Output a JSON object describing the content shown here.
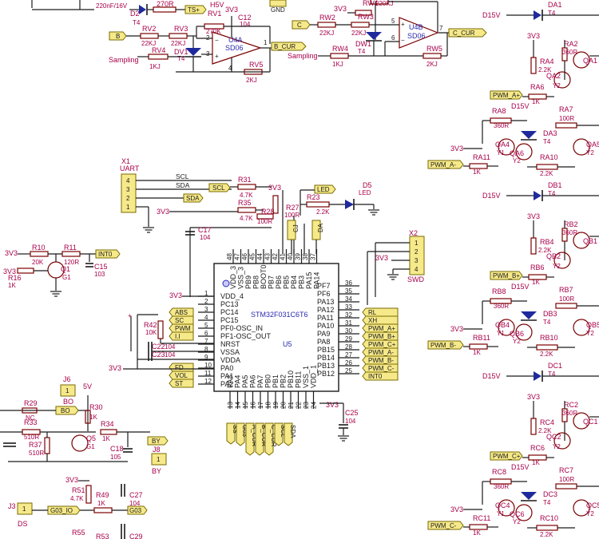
{
  "mcu": {
    "ref": "U5",
    "name": "STM32F031C6T6",
    "left_pins": [
      {
        "num": "1",
        "name": "VDD_4"
      },
      {
        "num": "2",
        "name": "PC13"
      },
      {
        "num": "3",
        "name": "PC14"
      },
      {
        "num": "4",
        "name": "PC15"
      },
      {
        "num": "5",
        "name": "PF0-OSC_IN"
      },
      {
        "num": "6",
        "name": "PF1-OSC_OUT"
      },
      {
        "num": "7",
        "name": "NRST"
      },
      {
        "num": "8",
        "name": "VSSA"
      },
      {
        "num": "9",
        "name": "VDDA"
      },
      {
        "num": "10",
        "name": "PA0"
      },
      {
        "num": "11",
        "name": "PA1"
      },
      {
        "num": "12",
        "name": "PA2"
      }
    ],
    "right_pins": [
      {
        "num": "36",
        "name": "PF7"
      },
      {
        "num": "35",
        "name": "PF6"
      },
      {
        "num": "34",
        "name": "PA13"
      },
      {
        "num": "33",
        "name": "PA12"
      },
      {
        "num": "32",
        "name": "PA11"
      },
      {
        "num": "31",
        "name": "PA10"
      },
      {
        "num": "30",
        "name": "PA9"
      },
      {
        "num": "29",
        "name": "PA8"
      },
      {
        "num": "28",
        "name": "PB15"
      },
      {
        "num": "27",
        "name": "PB14"
      },
      {
        "num": "26",
        "name": "PB13"
      },
      {
        "num": "25",
        "name": "PB12"
      }
    ],
    "top_pins": [
      {
        "num": "48",
        "name": "VDD_3"
      },
      {
        "num": "47",
        "name": "VSS_3"
      },
      {
        "num": "46",
        "name": "PB9"
      },
      {
        "num": "45",
        "name": "PB8"
      },
      {
        "num": "44",
        "name": "BOOT0"
      },
      {
        "num": "43",
        "name": "PB7"
      },
      {
        "num": "42",
        "name": "PB6"
      },
      {
        "num": "41",
        "name": "PB5"
      },
      {
        "num": "40",
        "name": "PB4"
      },
      {
        "num": "39",
        "name": "PB3"
      },
      {
        "num": "38",
        "name": "PA15"
      },
      {
        "num": "37",
        "name": "PA14"
      }
    ],
    "bottom_pins": [
      {
        "num": "13",
        "name": "PA3"
      },
      {
        "num": "14",
        "name": "PA4"
      },
      {
        "num": "15",
        "name": "PA5"
      },
      {
        "num": "16",
        "name": "PA6"
      },
      {
        "num": "17",
        "name": "PA7"
      },
      {
        "num": "18",
        "name": "PB0"
      },
      {
        "num": "19",
        "name": "PB1"
      },
      {
        "num": "20",
        "name": "PB2"
      },
      {
        "num": "21",
        "name": "PB10"
      },
      {
        "num": "22",
        "name": "PB11"
      },
      {
        "num": "23",
        "name": "VSS_1"
      },
      {
        "num": "24",
        "name": "VDD_1"
      }
    ]
  },
  "right_flags": [
    "RL",
    "XH",
    "PWM_A+",
    "PWM_B+",
    "PWM_C+",
    "PWM_A-",
    "PWM_B-",
    "PWM_C-",
    "INT0"
  ],
  "left_flags": [
    "ABS",
    "SC",
    "PWM",
    "I.I"
  ],
  "left_flags2": [
    "FD",
    "VOL",
    "ST"
  ],
  "bottom_flags": [
    "SS",
    "G03",
    "A_CUR",
    "B_CUR",
    "C_CUR",
    "SCL",
    "SDA"
  ],
  "top_flags": [
    "CJ",
    "DA"
  ],
  "opamp_a": {
    "ref": "U4A",
    "part": "SD06",
    "rv1": "RV1",
    "rv1_val": "270K",
    "rv2": "RV2",
    "rv2_val": "22KJ",
    "rv3": "RV3",
    "rv3_val": "22KJ",
    "rv4": "RV4",
    "rv4_val": "1KJ",
    "rv5": "RV5",
    "rv5_val": "2KJ",
    "dv1": "DV1",
    "dv1_val": "T4",
    "c12": "C12",
    "c12_val": "104",
    "supply": "3V3",
    "out": "B_CUR",
    "in": "B",
    "sampling": "Sampling",
    "gnd": "GND",
    "cap_top": "220nF/16V",
    "d2": "D2",
    "d2_val": "T4",
    "r270": "270R",
    "ts": "TS+",
    "h5v": "H5V"
  },
  "opamp_b": {
    "ref": "U4B",
    "part": "SD06",
    "rw1": "RW1",
    "rw1_val": "220KJ",
    "rw2": "RW2",
    "rw2_val": "22KJ",
    "rw3": "RW3",
    "rw3_val": "22KJ",
    "rw4": "RW4",
    "rw4_val": "1KJ",
    "rw5": "RW5",
    "rw5_val": "2KJ",
    "dw1": "DW1",
    "dw1_val": "T4",
    "supply": "3V3",
    "out": "C_CUR",
    "in": "C",
    "sampling": "Sampling",
    "pin5": "5",
    "pin6": "6",
    "pin7": "7"
  },
  "uart": {
    "ref": "X1",
    "name": "UART",
    "scl": "SCL",
    "sda": "SDA",
    "pins": [
      "4",
      "3",
      "2",
      "1"
    ],
    "r31": "R31",
    "r31_val": "4.7K",
    "r35": "R35",
    "r35_val": "4.7K",
    "r28": "R28",
    "r28_val": "100R",
    "supply": "3V3"
  },
  "led": {
    "d5": "D5",
    "d5_val": "LED",
    "r23": "R23",
    "r23_val": "2.2K",
    "r27": "R27",
    "r27_val": "100R",
    "net": "LED",
    "supply": "3V3"
  },
  "c17": {
    "ref": "C17",
    "val": "104"
  },
  "swd": {
    "ref": "X2",
    "name": "SWD",
    "pins": [
      "1",
      "2",
      "3",
      "4"
    ],
    "supply": "3V3"
  },
  "int0": {
    "r10": "R10",
    "r10_val": "20K",
    "r11": "R11",
    "r11_val": "120R",
    "c15": "C15",
    "c15_val": "103",
    "r16": "R16",
    "r16_val": "1K",
    "q1": "Q1",
    "q1_val": "G1",
    "supply": "3V3",
    "net": "INT0"
  },
  "reset": {
    "r42": "R42",
    "r42_val": "10K",
    "c22": "C22",
    "c22_val": "104",
    "c23": "C23",
    "c23_val": "104",
    "supply": "3V3"
  },
  "c25": {
    "ref": "C25",
    "val": "104",
    "supply": "3V3"
  },
  "bottom_left": {
    "j6": "J6",
    "j6_pin": "1",
    "bo": "BO",
    "r29": "R29",
    "r29_val": "NC",
    "r33": "R33",
    "r33_val": "510R",
    "r37": "R37",
    "r37_val": "510R",
    "r30": "R30",
    "r30_val": "1K",
    "r34": "R34",
    "r34_val": "1K",
    "q5": "Q5",
    "q5_val": "G1",
    "c18": "C18",
    "c18_val": "105",
    "j8": "J8",
    "j8_pin": "1",
    "by": "BY",
    "v5": "5V",
    "r51": "R51",
    "r51_val": "4.7K",
    "r49": "R49",
    "r49_val": "1K",
    "c27": "C27",
    "c27_val": "104",
    "g03": "G03_IO",
    "g03b": "G03",
    "j3": "J3",
    "j3_pin": "1",
    "ds": "DS",
    "r55": "R55",
    "r53": "R53",
    "c29": "C29",
    "supply": "3V3"
  },
  "phases": [
    {
      "d15": "D15V",
      "d": "DA1",
      "d_val": "T4",
      "ra2": "RA2",
      "ra2_val": "360R",
      "ra4": "RA4",
      "ra4_val": "2.2K",
      "qa1": "QA1",
      "qa2": "QA2",
      "qa2_val": "Y2",
      "ra6": "RA6",
      "ra6_val": "1K",
      "pwm_hi": "PWM_A+",
      "ra8": "RA8",
      "ra8_val": "360R",
      "ra7": "RA7",
      "ra7_val": "100R",
      "da3": "DA3",
      "da3_val": "T4",
      "qa5": "QA5",
      "qa4": "QA4",
      "qa4_val": "Y1",
      "qa6": "QA6",
      "qa6_val": "Y2",
      "ra10": "RA10",
      "ra10_val": "2.2K",
      "ra11": "RA11",
      "ra11_val": "1K",
      "pwm_lo": "PWM_A-",
      "supply": "3V3",
      "y2": "Y2"
    },
    {
      "d15": "D15V",
      "d": "DB1",
      "d_val": "T4",
      "ra2": "RB2",
      "ra2_val": "360R",
      "ra4": "RB4",
      "ra4_val": "2.2K",
      "qa1": "QB1",
      "qa2": "QB2",
      "qa2_val": "Y2",
      "ra6": "RB6",
      "ra6_val": "1K",
      "pwm_hi": "PWM_B+",
      "ra8": "RB8",
      "ra8_val": "360R",
      "ra7": "RB7",
      "ra7_val": "100R",
      "da3": "DB3",
      "da3_val": "T4",
      "qa5": "QB5",
      "qa4": "QB4",
      "qa4_val": "Y1",
      "qa6": "QB6",
      "qa6_val": "Y2",
      "ra10": "RB10",
      "ra10_val": "2.2K",
      "ra11": "RB11",
      "ra11_val": "1K",
      "pwm_lo": "PWM_B-",
      "supply": "3V3",
      "y2": "Y2"
    },
    {
      "d15": "D15V",
      "d": "DC1",
      "d_val": "T4",
      "ra2": "RC2",
      "ra2_val": "360R",
      "ra4": "RC4",
      "ra4_val": "2.2K",
      "qa1": "QC1",
      "qa2": "QC2",
      "qa2_val": "Y2",
      "ra6": "RC6",
      "ra6_val": "1K",
      "pwm_hi": "PWM_C+",
      "ra8": "RC8",
      "ra8_val": "360R",
      "ra7": "RC7",
      "ra7_val": "100R",
      "da3": "DC3",
      "da3_val": "T4",
      "qa5": "QC5",
      "qa4": "QC4",
      "qa4_val": "Y1",
      "qa6": "QC6",
      "qa6_val": "Y2",
      "ra10": "RC10",
      "ra10_val": "2.2K",
      "ra11": "RC11",
      "ra11_val": "1K",
      "pwm_lo": "PWM_C-",
      "supply": "3V3",
      "y2": "Y2"
    }
  ]
}
